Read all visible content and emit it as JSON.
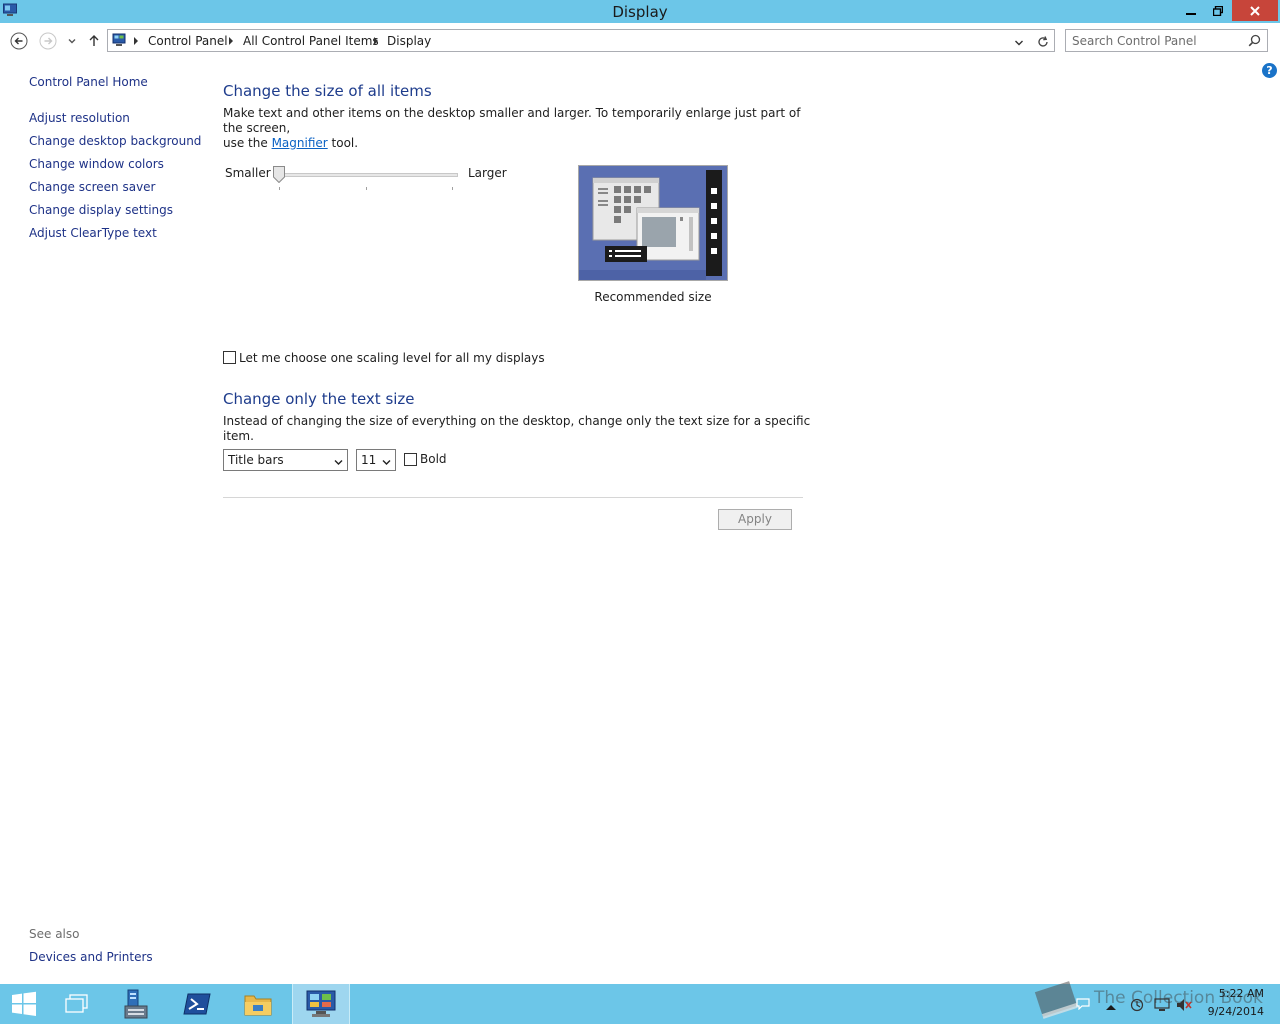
{
  "window": {
    "title": "Display"
  },
  "address": {
    "crumbs": [
      "Control Panel",
      "All Control Panel Items",
      "Display"
    ],
    "search_placeholder": "Search Control Panel"
  },
  "sidebar": {
    "home": "Control Panel Home",
    "items": [
      "Adjust resolution",
      "Change desktop background",
      "Change window colors",
      "Change screen saver",
      "Change display settings",
      "Adjust ClearType text"
    ],
    "see_also_title": "See also",
    "see_also_items": [
      "Devices and Printers"
    ]
  },
  "main": {
    "size_heading": "Change the size of all items",
    "size_desc_1": "Make text and other items on the desktop smaller and larger. To temporarily enlarge just part of the screen,",
    "size_desc_2_pre": "use the ",
    "size_desc_link": "Magnifier",
    "size_desc_2_post": " tool.",
    "slider_min_label": "Smaller",
    "slider_max_label": "Larger",
    "slider_level": 0,
    "preview_caption": "Recommended size",
    "one_scaling_label": "Let me choose one scaling level for all my displays",
    "one_scaling_checked": false,
    "text_heading": "Change only the text size",
    "text_desc": "Instead of changing the size of everything on the desktop, change only the text size for a specific item.",
    "item_select_value": "Title bars",
    "size_select_value": "11",
    "bold_label": "Bold",
    "bold_checked": false,
    "apply_label": "Apply"
  },
  "taskbar": {
    "time": "5:22 AM",
    "date": "9/24/2014",
    "watermark": "The Collection Book"
  },
  "colors": {
    "titlebar": "#6cc6e8",
    "close": "#c7453a",
    "heading": "#1e3c8c",
    "link": "#0b62c4"
  }
}
